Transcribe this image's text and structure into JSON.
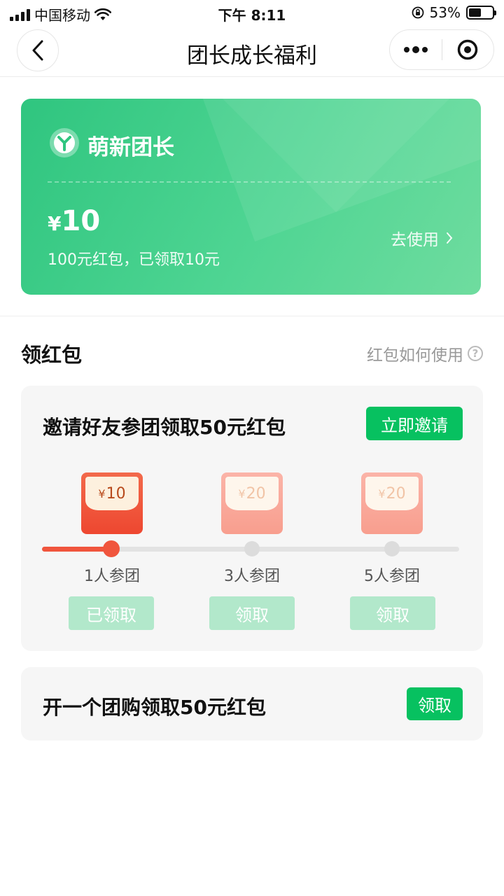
{
  "status_bar": {
    "carrier": "中国移动",
    "time": "下午 8:11",
    "battery": "53%",
    "battery_level": 0.53
  },
  "nav": {
    "title": "团长成长福利",
    "back_icon": "back-chevron-icon",
    "more_icon": "more-dots-icon",
    "close_icon": "target-icon"
  },
  "level_card": {
    "level_name": "萌新团长",
    "currency": "¥",
    "amount": "10",
    "description": "100元红包，已领取10元",
    "use_link": "去使用",
    "colors": {
      "start": "#2fc57f",
      "end": "#6fdc9f"
    }
  },
  "section": {
    "title": "领红包",
    "help_link": "红包如何使用",
    "help_icon": "?"
  },
  "invite": {
    "title": "邀请好友参团领取50元红包",
    "button": "立即邀请",
    "progress": 0.17,
    "tiers": [
      {
        "amount": "10",
        "currency": "¥",
        "condition": "1人参团",
        "button": "已领取",
        "achieved": true
      },
      {
        "amount": "20",
        "currency": "¥",
        "condition": "3人参团",
        "button": "领取",
        "achieved": false
      },
      {
        "amount": "20",
        "currency": "¥",
        "condition": "5人参团",
        "button": "领取",
        "achieved": false
      }
    ]
  },
  "group_buy": {
    "title": "开一个团购领取50元红包",
    "button": "领取"
  },
  "colors": {
    "brand_green": "#07c160",
    "disabled_green": "#b2e8cb",
    "progress_red": "#f0553d"
  }
}
